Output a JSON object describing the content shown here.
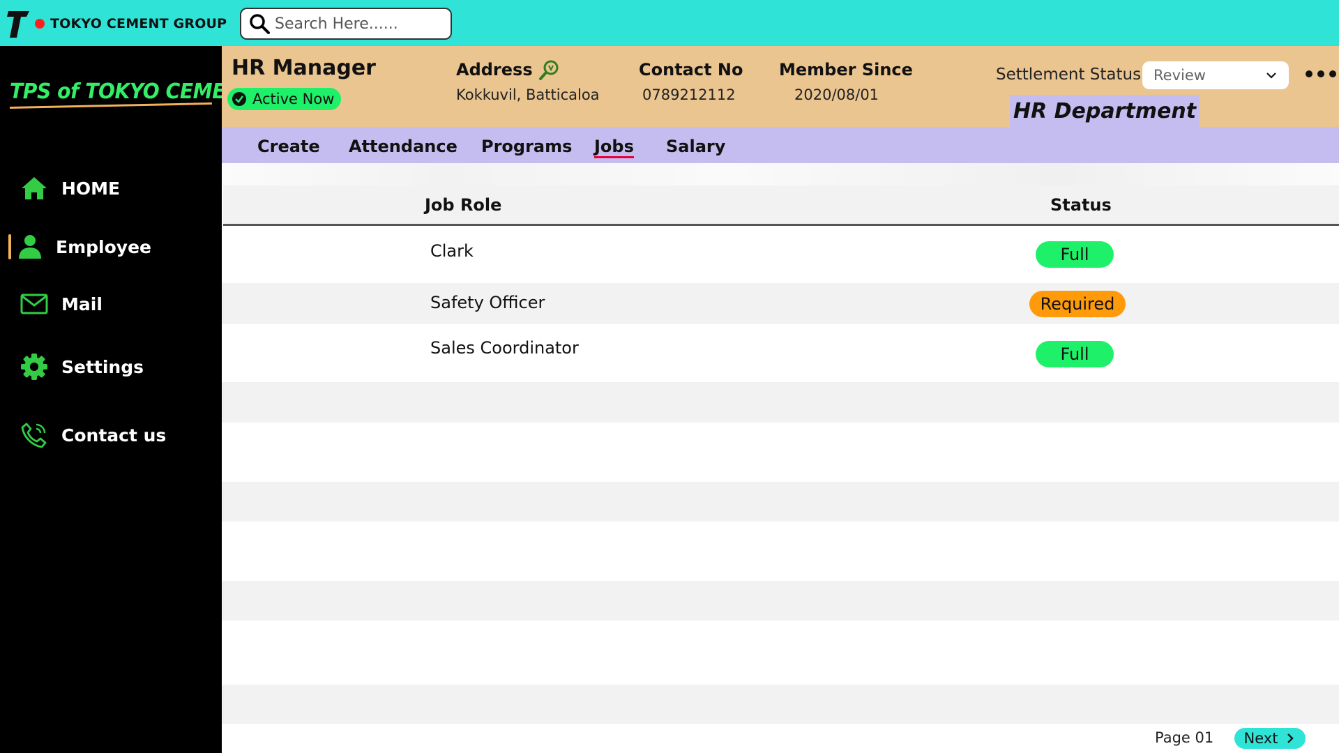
{
  "topbar": {
    "brand_name": "TOKYO CEMENT GROUP",
    "search_placeholder": "Search Here......"
  },
  "sidebar": {
    "logo_text": "TPS of TOKYO CEMENT",
    "items": [
      {
        "label": "HOME",
        "icon": "home-icon"
      },
      {
        "label": "Employee",
        "icon": "user-icon",
        "active": true
      },
      {
        "label": "Mail",
        "icon": "mail-icon"
      },
      {
        "label": "Settings",
        "icon": "gear-icon"
      },
      {
        "label": "Contact us",
        "icon": "phone-icon"
      }
    ]
  },
  "header": {
    "title": "HR Manager",
    "status": "Active Now",
    "address_label": "Address",
    "address_value": "Kokkuvil, Batticaloa",
    "contact_label": "Contact No",
    "contact_value": "0789212112",
    "member_label": "Member Since",
    "member_value": "2020/08/01",
    "settlement_label": "Settlement Status",
    "settlement_value": "Review",
    "department": "HR Department"
  },
  "tabs": [
    {
      "label": "Create"
    },
    {
      "label": "Attendance"
    },
    {
      "label": "Programs"
    },
    {
      "label": "Jobs",
      "active": true
    },
    {
      "label": "Salary"
    }
  ],
  "table": {
    "headers": {
      "role": "Job Role",
      "status": "Status"
    },
    "rows": [
      {
        "role": "Clark",
        "status": "Full"
      },
      {
        "role": "Safety Officer",
        "status": "Required"
      },
      {
        "role": "Sales Coordinator",
        "status": "Full"
      }
    ]
  },
  "pagination": {
    "page": "Page 01",
    "next": "Next"
  },
  "colors": {
    "topbar": "#2fe3d6",
    "header": "#ebc590",
    "tabs": "#c5bdf0",
    "full_status": "#1ef06a",
    "required_status": "#ff9a0a",
    "sidebar_icon": "#33cc44"
  }
}
